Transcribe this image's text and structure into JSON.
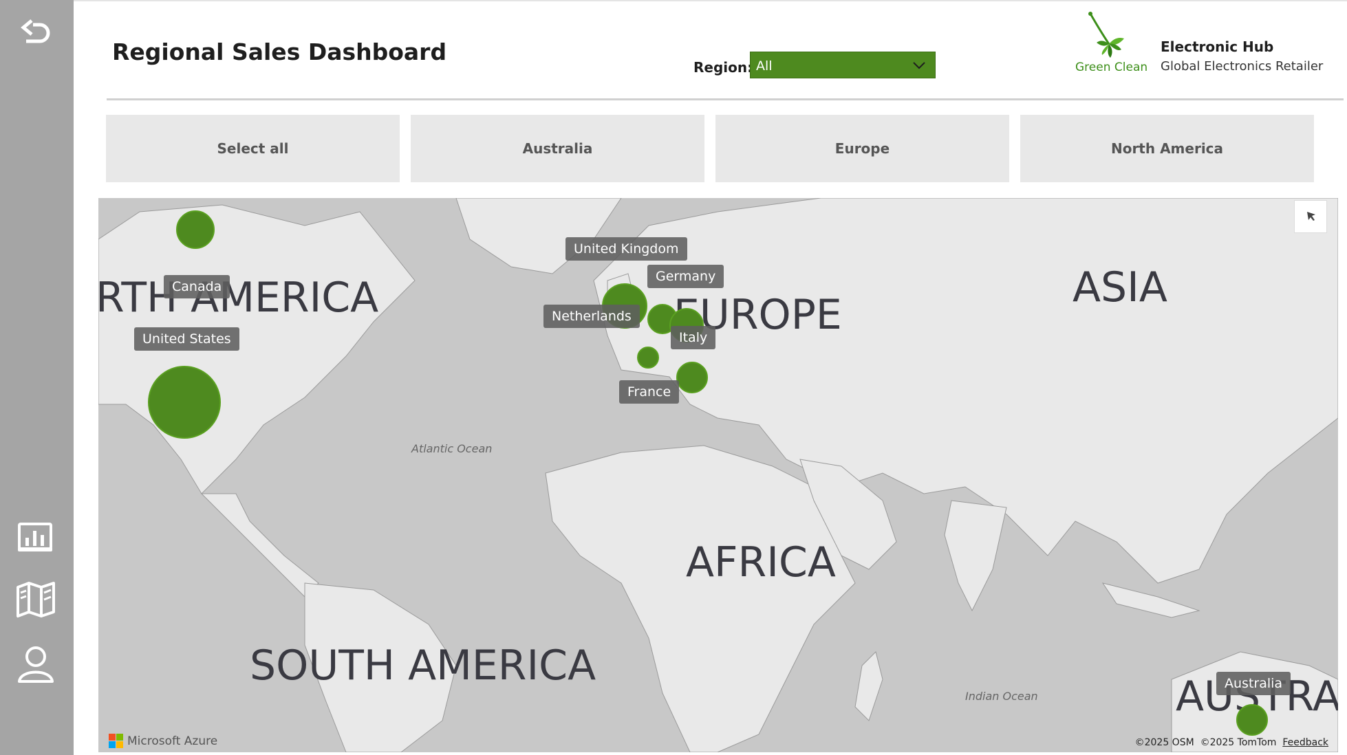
{
  "header": {
    "title": "Regional Sales Dashboard",
    "region_label": "Region:",
    "region_value": "All"
  },
  "brand": {
    "logo_text": "Green Clean",
    "company_name": "Electronic Hub",
    "company_subtitle": "Global Electronics Retailer"
  },
  "tabs": [
    {
      "label": "Select all"
    },
    {
      "label": "Australia"
    },
    {
      "label": "Europe"
    },
    {
      "label": "North America"
    }
  ],
  "sidebar": {
    "icons": [
      "back-icon",
      "report-chart-icon",
      "map-icon",
      "user-icon"
    ]
  },
  "map": {
    "continent_labels": {
      "north_america": "RTH AMERICA",
      "europe": "EUROPE",
      "asia": "ASIA",
      "africa": "AFRICA",
      "south_america": "SOUTH AMERICA",
      "australia": "AUSTRAI"
    },
    "ocean_labels": {
      "atlantic": "Atlantic Ocean",
      "indian": "Indian Ocean"
    },
    "country_labels": {
      "canada": "Canada",
      "united_states": "United States",
      "united_kingdom": "United Kingdom",
      "germany": "Germany",
      "netherlands": "Netherlands",
      "italy": "Italy",
      "france": "France",
      "australia": "Australia"
    },
    "attribution": {
      "provider": "Microsoft Azure",
      "osm": "©2025 OSM",
      "tomtom": "©2025 TomTom",
      "feedback": "Feedback"
    }
  },
  "colors": {
    "accent": "#4e8a1f",
    "sidebar": "#a5a5a5",
    "tab_bg": "#e8e8e8",
    "map_water": "#c8c8c8",
    "map_land": "#e9e9e9"
  }
}
